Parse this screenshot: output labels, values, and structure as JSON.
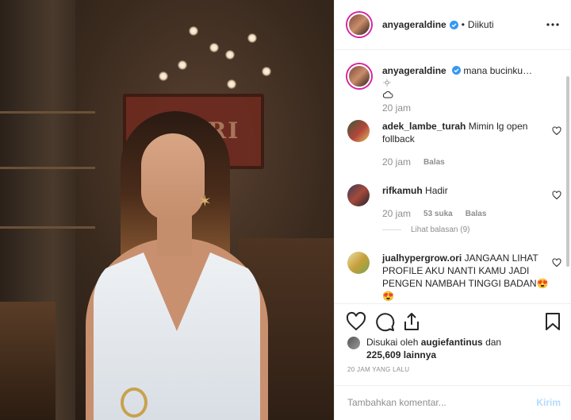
{
  "header": {
    "username": "anyageraldine",
    "separator": "•",
    "follow_status": "Diikuti"
  },
  "caption": {
    "username": "anyageraldine",
    "text": "mana bucinku…",
    "time": "20 jam"
  },
  "comments": [
    {
      "username": "adek_lambe_turah",
      "text": "Mimin lg open follback",
      "time": "20 jam",
      "likes": "",
      "reply": "Balas"
    },
    {
      "username": "rifkamuh",
      "text": "Hadir",
      "time": "20 jam",
      "likes": "53 suka",
      "reply": "Balas",
      "view_replies": "Lihat balasan (9)"
    },
    {
      "username": "jualhypergrow.ori",
      "text": "JANGAAN LIHAT PROFILE AKU NANTI KAMU JADI PENGEN NAMBAH TINGGI BADAN😍😍"
    }
  ],
  "likes": {
    "prefix": "Disukai oleh",
    "user": "augiefantinus",
    "joiner": "dan",
    "count": "225,609",
    "suffix": "lainnya"
  },
  "timeago": "20 JAM YANG LALU",
  "add_comment": {
    "placeholder": "Tambahkan komentar...",
    "post_label": "Kirim"
  },
  "photo": {
    "sign_text": "OSARI"
  },
  "colors": {
    "verified": "#3897f0",
    "story_ring": "#d6249f",
    "muted": "#8e8e8e",
    "post_button_disabled": "#b3dbff"
  }
}
